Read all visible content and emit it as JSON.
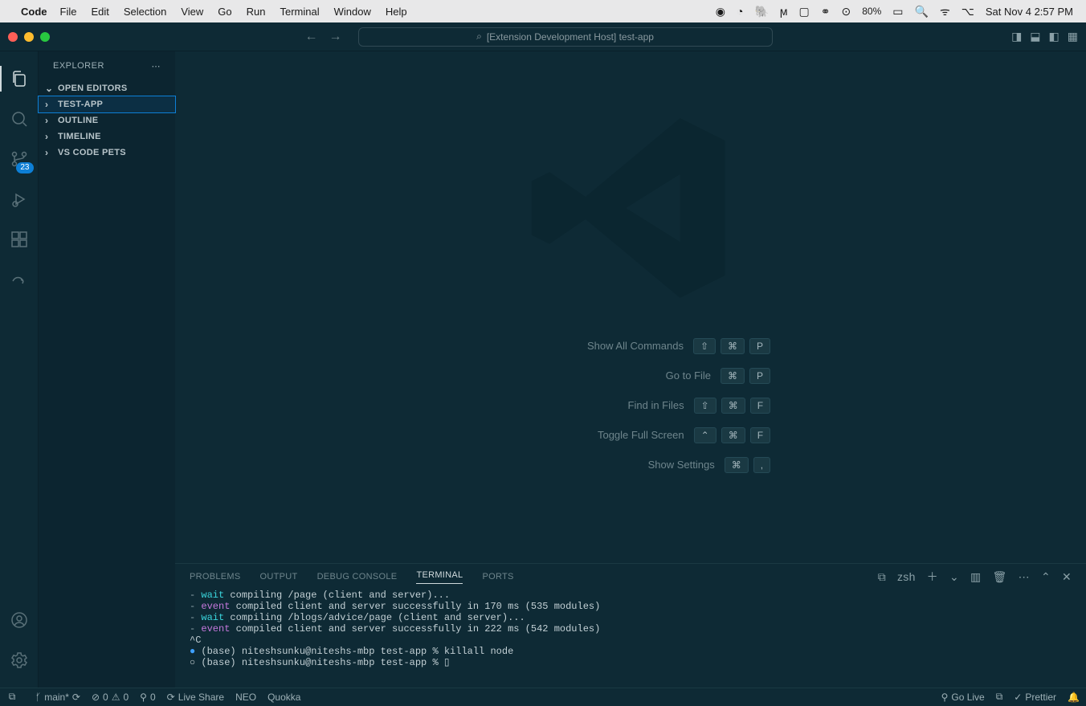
{
  "menubar": {
    "app_name": "Code",
    "items": [
      "File",
      "Edit",
      "Selection",
      "View",
      "Go",
      "Run",
      "Terminal",
      "Window",
      "Help"
    ],
    "battery": "80%",
    "datetime": "Sat Nov 4  2:57 PM"
  },
  "titlebar": {
    "command_center": "[Extension Development Host] test-app"
  },
  "activity": {
    "badge_scm": "23"
  },
  "sidebar": {
    "header": "EXPLORER",
    "sections": [
      "OPEN EDITORS",
      "TEST-APP",
      "OUTLINE",
      "TIMELINE",
      "VS CODE PETS"
    ]
  },
  "welcome": {
    "shortcuts": [
      {
        "label": "Show All Commands",
        "keys": [
          "⇧",
          "⌘",
          "P"
        ]
      },
      {
        "label": "Go to File",
        "keys": [
          "⌘",
          "P"
        ]
      },
      {
        "label": "Find in Files",
        "keys": [
          "⇧",
          "⌘",
          "F"
        ]
      },
      {
        "label": "Toggle Full Screen",
        "keys": [
          "⌃",
          "⌘",
          "F"
        ]
      },
      {
        "label": "Show Settings",
        "keys": [
          "⌘",
          ","
        ]
      }
    ]
  },
  "panel": {
    "tabs": [
      "PROBLEMS",
      "OUTPUT",
      "DEBUG CONSOLE",
      "TERMINAL",
      "PORTS"
    ],
    "shell": "zsh",
    "lines": [
      {
        "prefix": "- ",
        "kw": "wait",
        "rest": " compiling /page (client and server)..."
      },
      {
        "prefix": "- ",
        "kw": "event",
        "rest": " compiled client and server successfully in 170 ms (535 modules)"
      },
      {
        "prefix": "- ",
        "kw": "wait",
        "rest": " compiling /blogs/advice/page (client and server)..."
      },
      {
        "prefix": "- ",
        "kw": "event",
        "rest": " compiled client and server successfully in 222 ms (542 modules)"
      },
      {
        "plain": "^C"
      },
      {
        "bullet": "●",
        "bclass": "circBlue",
        "plain": " (base) niteshsunku@niteshs-mbp test-app % killall node"
      },
      {
        "bullet": "○",
        "bclass": "circWhite",
        "plain": " (base) niteshsunku@niteshs-mbp test-app % ▯"
      }
    ]
  },
  "status": {
    "branch": "main*",
    "errors": "0",
    "warnings": "0",
    "ports": "0",
    "live_share": "Live Share",
    "neo": "NEO",
    "quokka": "Quokka",
    "golive": "Go Live",
    "prettier": "Prettier"
  }
}
